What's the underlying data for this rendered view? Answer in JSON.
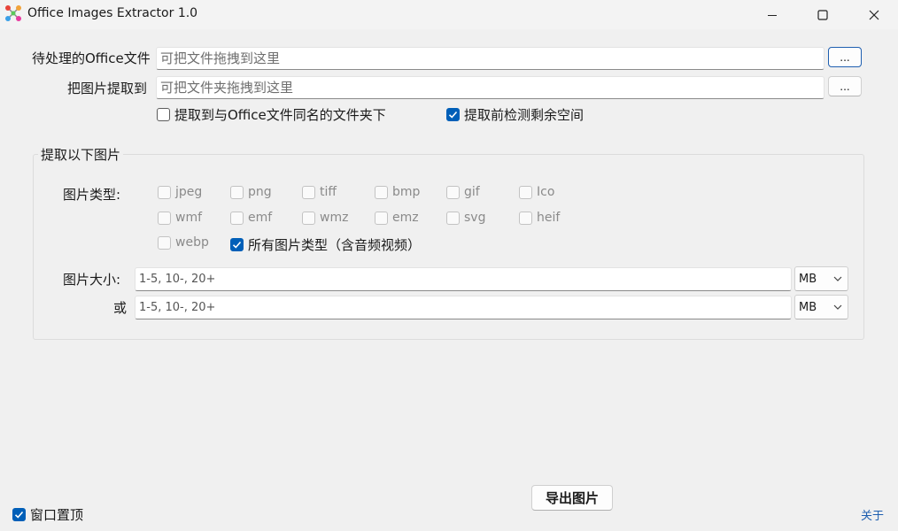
{
  "window": {
    "title": "Office Images Extractor 1.0"
  },
  "source": {
    "label": "待处理的Office文件",
    "placeholder": "可把文件拖拽到这里",
    "browse_label": "..."
  },
  "target": {
    "label": "把图片提取到",
    "placeholder": "可把文件夹拖拽到这里",
    "browse_label": "..."
  },
  "options": {
    "same_name_folder": {
      "label": "提取到与Office文件同名的文件夹下",
      "checked": false
    },
    "check_space": {
      "label": "提取前检测剩余空间",
      "checked": true
    }
  },
  "filter_group": {
    "title": "提取以下图片",
    "types_label": "图片类型:",
    "types": [
      {
        "label": "jpeg",
        "checked": false
      },
      {
        "label": "png",
        "checked": false
      },
      {
        "label": "tiff",
        "checked": false
      },
      {
        "label": "bmp",
        "checked": false
      },
      {
        "label": "gif",
        "checked": false
      },
      {
        "label": "Ico",
        "checked": false
      },
      {
        "label": "wmf",
        "checked": false
      },
      {
        "label": "emf",
        "checked": false
      },
      {
        "label": "wmz",
        "checked": false
      },
      {
        "label": "emz",
        "checked": false
      },
      {
        "label": "svg",
        "checked": false
      },
      {
        "label": "heif",
        "checked": false
      },
      {
        "label": "webp",
        "checked": false
      }
    ],
    "all_types": {
      "label": "所有图片类型（含音频视频）",
      "checked": true
    },
    "size_label": "图片大小:",
    "or_label": "或",
    "size1": {
      "value": "1-5, 10-, 20+",
      "unit": "MB"
    },
    "size2": {
      "value": "1-5, 10-, 20+",
      "unit": "MB"
    }
  },
  "footer": {
    "topmost": {
      "label": "窗口置顶",
      "checked": true
    },
    "export_label": "导出图片",
    "about_label": "关于"
  },
  "colors": {
    "accent": "#005fb8",
    "link": "#1f5fb0",
    "background": "#f0f0f0"
  }
}
